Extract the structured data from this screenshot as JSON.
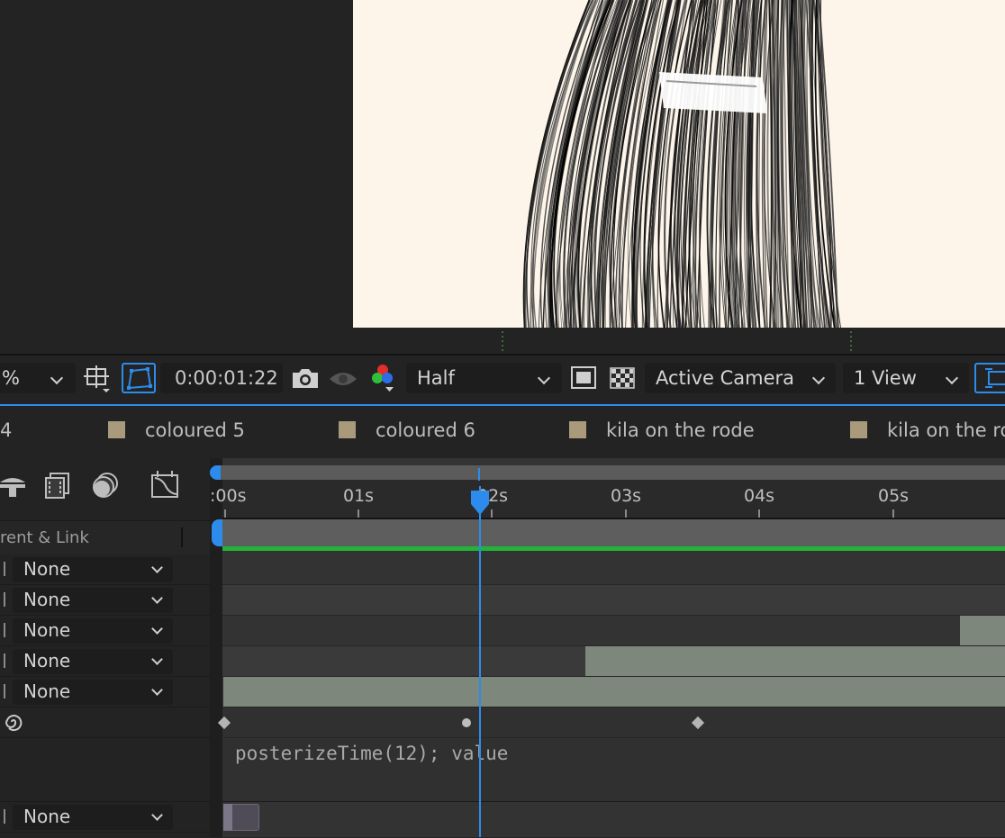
{
  "viewer": {
    "zoom_value": "%",
    "timecode": "0:00:01:22",
    "resolution": "Half",
    "camera": "Active Camera",
    "views": "1 View"
  },
  "tabs": [
    {
      "label": "4"
    },
    {
      "label": "coloured 5"
    },
    {
      "label": "coloured 6"
    },
    {
      "label": "kila on the rode"
    },
    {
      "label": "kila on the ro"
    }
  ],
  "layer_panel": {
    "header_label": "rent & Link",
    "parent_values": [
      "None",
      "None",
      "None",
      "None",
      "None",
      "None"
    ]
  },
  "timeline": {
    "time_labels": [
      ":00s",
      "01s",
      "02s",
      "03s",
      "04s",
      "05s"
    ],
    "expression": "posterizeTime(12); value",
    "current_time_sec": 1.92
  },
  "colors": {
    "accent": "#2d8ceb",
    "work_area_green": "#23b33a",
    "label_swatch": "#a99a7c",
    "layer_bar": "#7d877c"
  }
}
